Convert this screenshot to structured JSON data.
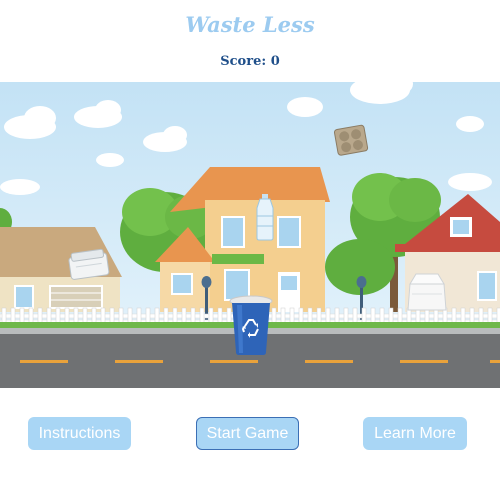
{
  "game": {
    "title": "Waste Less",
    "score_label": "Score:",
    "score_value": "0"
  },
  "buttons": {
    "instructions": "Instructions",
    "start": "Start Game",
    "learn_more": "Learn More"
  },
  "scene": {
    "falling_items": [
      "egg-carton",
      "plastic-bottle",
      "plastic-container",
      "foam-container"
    ],
    "bin": "recycling-bin",
    "bin_symbol": "recycle-icon"
  },
  "colors": {
    "title": "#9ccbf0",
    "score": "#1f4f8a",
    "button_bg": "#a9d6f5",
    "button_text": "#ffffff",
    "start_border": "#3b6fb5",
    "sky": "#cfe8f6",
    "road": "#6f7173",
    "bin": "#2e64b8"
  }
}
